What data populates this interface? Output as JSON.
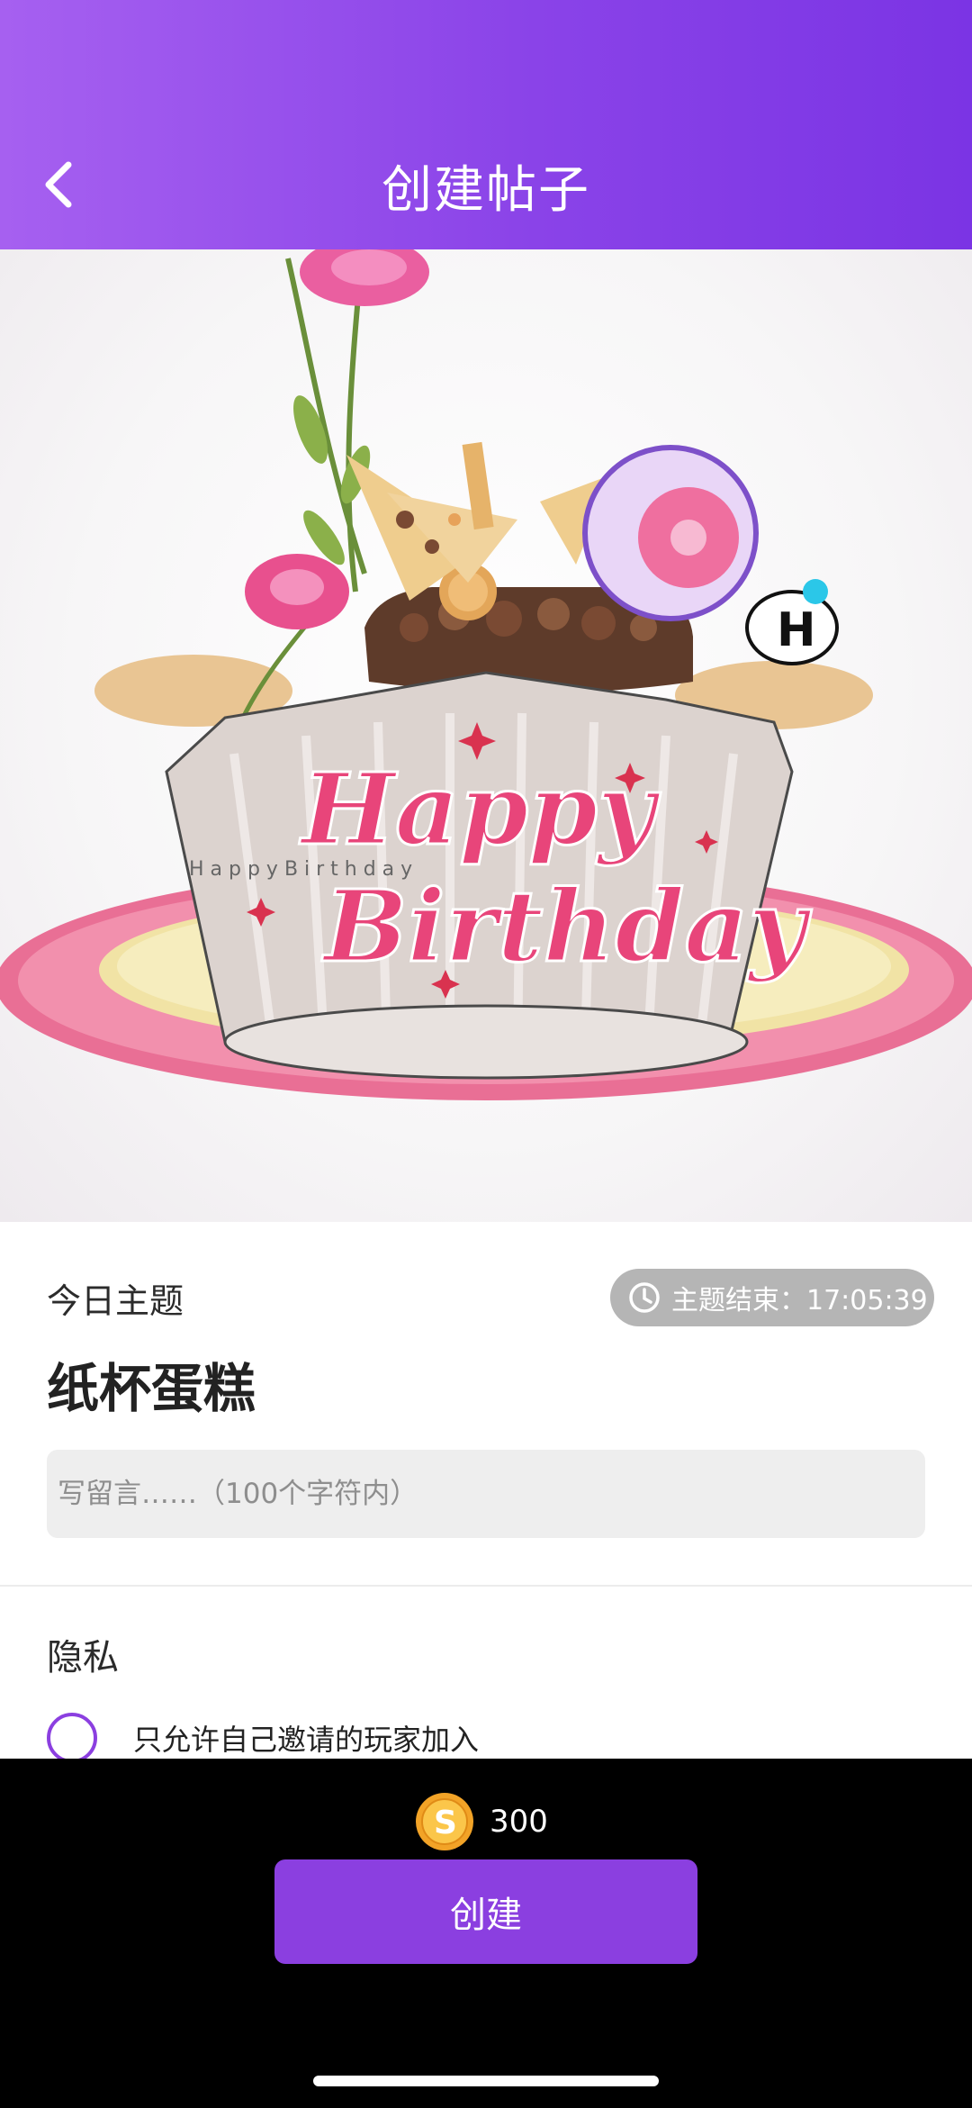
{
  "header": {
    "title": "创建帖子",
    "back_icon": "chevron-left-icon",
    "gradient": [
      "#a660f0",
      "#7b34e4"
    ]
  },
  "hero": {
    "image": "birthday-cake-illustration",
    "happy_text": "Happy",
    "birthday_text": "Birthday",
    "band_text": "H a p p y   B i r t h d a y"
  },
  "theme": {
    "label": "今日主题",
    "timer_icon": "clock-icon",
    "timer_text": "主题结束：17:05:39",
    "name": "纸杯蛋糕"
  },
  "message": {
    "placeholder": "写留言……（100个字符内）",
    "value": ""
  },
  "privacy": {
    "title": "隐私",
    "option_label": "只允许自己邀请的玩家加入",
    "option_checked": false
  },
  "footer": {
    "coin_icon": "coin-icon",
    "cost": "300",
    "create_label": "创建"
  },
  "colors": {
    "accent": "#8b3fe0",
    "badge": "#b5b5b5"
  }
}
